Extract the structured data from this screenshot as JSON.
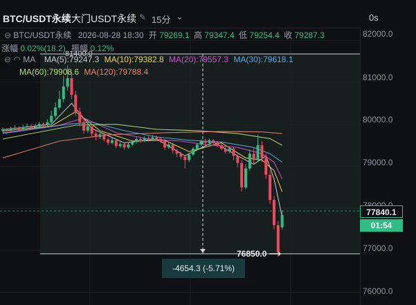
{
  "title": {
    "symbol": "BTC/USDT永续",
    "exchange": "大门USDT永续",
    "interval": "15分",
    "countdown": "0s"
  },
  "ohlc": {
    "symbol": "BTC/USDT永续",
    "datetime": "2026-08-28 18:30",
    "open_label": "开",
    "open": "79269.1",
    "high_label": "高",
    "high": "79347.4",
    "low_label": "低",
    "low": "79254.4",
    "close_label": "收",
    "close": "79287.3"
  },
  "change": {
    "change_label": "涨幅",
    "change_value": "0.02%(18.2)",
    "amplitude_label": "振幅",
    "amplitude_value": "0.12%"
  },
  "ma": {
    "label": "MA",
    "lines": [
      {
        "text": "MA(5):79247.3",
        "color": "#c9ccd3"
      },
      {
        "text": "MA(10):79382.8",
        "color": "#f0d64a"
      },
      {
        "text": "MA(20):79557.3",
        "color": "#d34fd0"
      },
      {
        "text": "MA(30):79618.1",
        "color": "#5aa8e6"
      },
      {
        "text": "MA(60):79908.6",
        "color": "#b6df7a"
      },
      {
        "text": "MA(120):79788.4",
        "color": "#e8836e"
      }
    ]
  },
  "price_axis": [
    "82000.0",
    "81000.0",
    "80000.0",
    "79000.0",
    "78000.0",
    "77000.0",
    "76000.0"
  ],
  "tags": {
    "last_price": "77840.1",
    "countdown": "01:54",
    "high_marker": "81400.0",
    "low_marker": "76850.0"
  },
  "measure": {
    "text": "-4654.3 (-5.71%)"
  },
  "colors": {
    "up": "#2ebd85",
    "down": "#f6465d",
    "accent": "#2ebd85"
  },
  "chart_data": {
    "type": "candlestick",
    "ylim": [
      75700,
      82300
    ],
    "candles": [
      {
        "o": 79850,
        "c": 79880,
        "h": 79930,
        "l": 79800
      },
      {
        "o": 79880,
        "c": 79860,
        "h": 79910,
        "l": 79830
      },
      {
        "o": 79860,
        "c": 79900,
        "h": 79950,
        "l": 79840
      },
      {
        "o": 79900,
        "c": 79920,
        "h": 79980,
        "l": 79870
      },
      {
        "o": 79920,
        "c": 79880,
        "h": 79960,
        "l": 79850
      },
      {
        "o": 79880,
        "c": 79930,
        "h": 79990,
        "l": 79860
      },
      {
        "o": 79930,
        "c": 79960,
        "h": 80020,
        "l": 79900
      },
      {
        "o": 79960,
        "c": 79920,
        "h": 80000,
        "l": 79890
      },
      {
        "o": 79920,
        "c": 79950,
        "h": 80010,
        "l": 79900
      },
      {
        "o": 79950,
        "c": 80010,
        "h": 80060,
        "l": 79930
      },
      {
        "o": 80010,
        "c": 79980,
        "h": 80050,
        "l": 79950
      },
      {
        "o": 79980,
        "c": 80050,
        "h": 80120,
        "l": 79960
      },
      {
        "o": 80050,
        "c": 80200,
        "h": 80320,
        "l": 80020
      },
      {
        "o": 80200,
        "c": 80400,
        "h": 80520,
        "l": 80150
      },
      {
        "o": 80400,
        "c": 80600,
        "h": 80800,
        "l": 80350
      },
      {
        "o": 80600,
        "c": 80900,
        "h": 81150,
        "l": 80520
      },
      {
        "o": 80900,
        "c": 81100,
        "h": 81400,
        "l": 80800
      },
      {
        "o": 81100,
        "c": 80700,
        "h": 81250,
        "l": 80600
      },
      {
        "o": 80700,
        "c": 80300,
        "h": 80800,
        "l": 80200
      },
      {
        "o": 80300,
        "c": 80050,
        "h": 80400,
        "l": 79950
      },
      {
        "o": 80050,
        "c": 79850,
        "h": 80150,
        "l": 79780
      },
      {
        "o": 79850,
        "c": 79950,
        "h": 80050,
        "l": 79800
      },
      {
        "o": 79950,
        "c": 79780,
        "h": 80000,
        "l": 79700
      },
      {
        "o": 79780,
        "c": 79700,
        "h": 79850,
        "l": 79620
      },
      {
        "o": 79700,
        "c": 79760,
        "h": 79820,
        "l": 79650
      },
      {
        "o": 79760,
        "c": 79640,
        "h": 79800,
        "l": 79590
      },
      {
        "o": 79640,
        "c": 79560,
        "h": 79680,
        "l": 79500
      },
      {
        "o": 79560,
        "c": 79620,
        "h": 79680,
        "l": 79520
      },
      {
        "o": 79620,
        "c": 79480,
        "h": 79660,
        "l": 79430
      },
      {
        "o": 79480,
        "c": 79530,
        "h": 79580,
        "l": 79440
      },
      {
        "o": 79530,
        "c": 79450,
        "h": 79570,
        "l": 79400
      },
      {
        "o": 79450,
        "c": 79520,
        "h": 79580,
        "l": 79420
      },
      {
        "o": 79520,
        "c": 79580,
        "h": 79620,
        "l": 79480
      },
      {
        "o": 79580,
        "c": 79650,
        "h": 79710,
        "l": 79540
      },
      {
        "o": 79650,
        "c": 79600,
        "h": 79700,
        "l": 79560
      },
      {
        "o": 79600,
        "c": 79670,
        "h": 79720,
        "l": 79570
      },
      {
        "o": 79670,
        "c": 79630,
        "h": 79720,
        "l": 79590
      },
      {
        "o": 79630,
        "c": 79690,
        "h": 79740,
        "l": 79600
      },
      {
        "o": 79690,
        "c": 79660,
        "h": 79730,
        "l": 79610
      },
      {
        "o": 79660,
        "c": 79600,
        "h": 79700,
        "l": 79560
      },
      {
        "o": 79600,
        "c": 79450,
        "h": 79650,
        "l": 79400
      },
      {
        "o": 79450,
        "c": 79520,
        "h": 79580,
        "l": 79420
      },
      {
        "o": 79520,
        "c": 79380,
        "h": 79560,
        "l": 79300
      },
      {
        "o": 79380,
        "c": 79300,
        "h": 79420,
        "l": 79220
      },
      {
        "o": 79300,
        "c": 79230,
        "h": 79350,
        "l": 79170
      },
      {
        "o": 79230,
        "c": 79150,
        "h": 79260,
        "l": 78950
      },
      {
        "o": 79150,
        "c": 79280,
        "h": 79320,
        "l": 79100
      },
      {
        "o": 79280,
        "c": 79420,
        "h": 79460,
        "l": 79250
      },
      {
        "o": 79420,
        "c": 79520,
        "h": 79560,
        "l": 79380
      },
      {
        "o": 79520,
        "c": 79600,
        "h": 79640,
        "l": 79480
      },
      {
        "o": 79600,
        "c": 79560,
        "h": 79650,
        "l": 79500
      },
      {
        "o": 79560,
        "c": 79620,
        "h": 79660,
        "l": 79520
      },
      {
        "o": 79620,
        "c": 79570,
        "h": 79650,
        "l": 79520
      },
      {
        "o": 79570,
        "c": 79500,
        "h": 79600,
        "l": 79460
      },
      {
        "o": 79500,
        "c": 79420,
        "h": 79540,
        "l": 79380
      },
      {
        "o": 79420,
        "c": 79350,
        "h": 79460,
        "l": 79300
      },
      {
        "o": 79350,
        "c": 79420,
        "h": 79460,
        "l": 79310
      },
      {
        "o": 79420,
        "c": 79250,
        "h": 79460,
        "l": 79150
      },
      {
        "o": 79250,
        "c": 79080,
        "h": 79290,
        "l": 78980
      },
      {
        "o": 79080,
        "c": 78500,
        "h": 79150,
        "l": 78400
      },
      {
        "o": 78500,
        "c": 78950,
        "h": 79050,
        "l": 78450
      },
      {
        "o": 78950,
        "c": 79300,
        "h": 79400,
        "l": 78900
      },
      {
        "o": 79300,
        "c": 79150,
        "h": 79450,
        "l": 79050
      },
      {
        "o": 79150,
        "c": 79500,
        "h": 79750,
        "l": 79100
      },
      {
        "o": 79500,
        "c": 79200,
        "h": 79600,
        "l": 79100
      },
      {
        "o": 79200,
        "c": 78800,
        "h": 79300,
        "l": 78700
      },
      {
        "o": 78800,
        "c": 78200,
        "h": 78900,
        "l": 78100
      },
      {
        "o": 78200,
        "c": 77600,
        "h": 78300,
        "l": 77500
      },
      {
        "o": 77600,
        "c": 76950,
        "h": 77700,
        "l": 76850
      },
      {
        "o": 77550,
        "c": 77840,
        "h": 77950,
        "l": 77500
      }
    ],
    "ma_series": [
      {
        "name": "MA(5)",
        "color": "#c9ccd3",
        "values": [
          [
            0,
            79870
          ],
          [
            12,
            80000
          ],
          [
            17,
            80500
          ],
          [
            22,
            79900
          ],
          [
            30,
            79560
          ],
          [
            38,
            79650
          ],
          [
            45,
            79250
          ],
          [
            52,
            79580
          ],
          [
            58,
            79250
          ],
          [
            62,
            79050
          ],
          [
            65,
            79250
          ],
          [
            67,
            78700
          ],
          [
            69,
            77800
          ]
        ]
      },
      {
        "name": "MA(10)",
        "color": "#f0d64a",
        "values": [
          [
            0,
            79840
          ],
          [
            12,
            79960
          ],
          [
            18,
            80300
          ],
          [
            24,
            79850
          ],
          [
            32,
            79600
          ],
          [
            40,
            79620
          ],
          [
            46,
            79350
          ],
          [
            54,
            79560
          ],
          [
            60,
            79200
          ],
          [
            64,
            79150
          ],
          [
            67,
            78900
          ],
          [
            69,
            78400
          ]
        ]
      },
      {
        "name": "MA(20)",
        "color": "#d34fd0",
        "values": [
          [
            0,
            79800
          ],
          [
            14,
            79980
          ],
          [
            20,
            80150
          ],
          [
            28,
            79800
          ],
          [
            36,
            79650
          ],
          [
            44,
            79600
          ],
          [
            50,
            79520
          ],
          [
            58,
            79450
          ],
          [
            64,
            79300
          ],
          [
            67,
            79100
          ],
          [
            69,
            78700
          ]
        ]
      },
      {
        "name": "MA(30)",
        "color": "#5aa8e6",
        "values": [
          [
            0,
            79780
          ],
          [
            16,
            80000
          ],
          [
            22,
            80050
          ],
          [
            30,
            79850
          ],
          [
            38,
            79700
          ],
          [
            46,
            79620
          ],
          [
            54,
            79580
          ],
          [
            62,
            79450
          ],
          [
            66,
            79300
          ],
          [
            69,
            79100
          ]
        ]
      },
      {
        "name": "MA(60)",
        "color": "#b6df7a",
        "values": [
          [
            0,
            79650
          ],
          [
            18,
            79980
          ],
          [
            28,
            80000
          ],
          [
            38,
            79880
          ],
          [
            48,
            79850
          ],
          [
            58,
            79780
          ],
          [
            66,
            79660
          ],
          [
            69,
            79500
          ]
        ]
      },
      {
        "name": "MA(120)",
        "color": "#e8836e",
        "values": [
          [
            0,
            79200
          ],
          [
            14,
            79600
          ],
          [
            26,
            79750
          ],
          [
            40,
            79800
          ],
          [
            54,
            79830
          ],
          [
            64,
            79820
          ],
          [
            69,
            79780
          ]
        ]
      }
    ]
  }
}
